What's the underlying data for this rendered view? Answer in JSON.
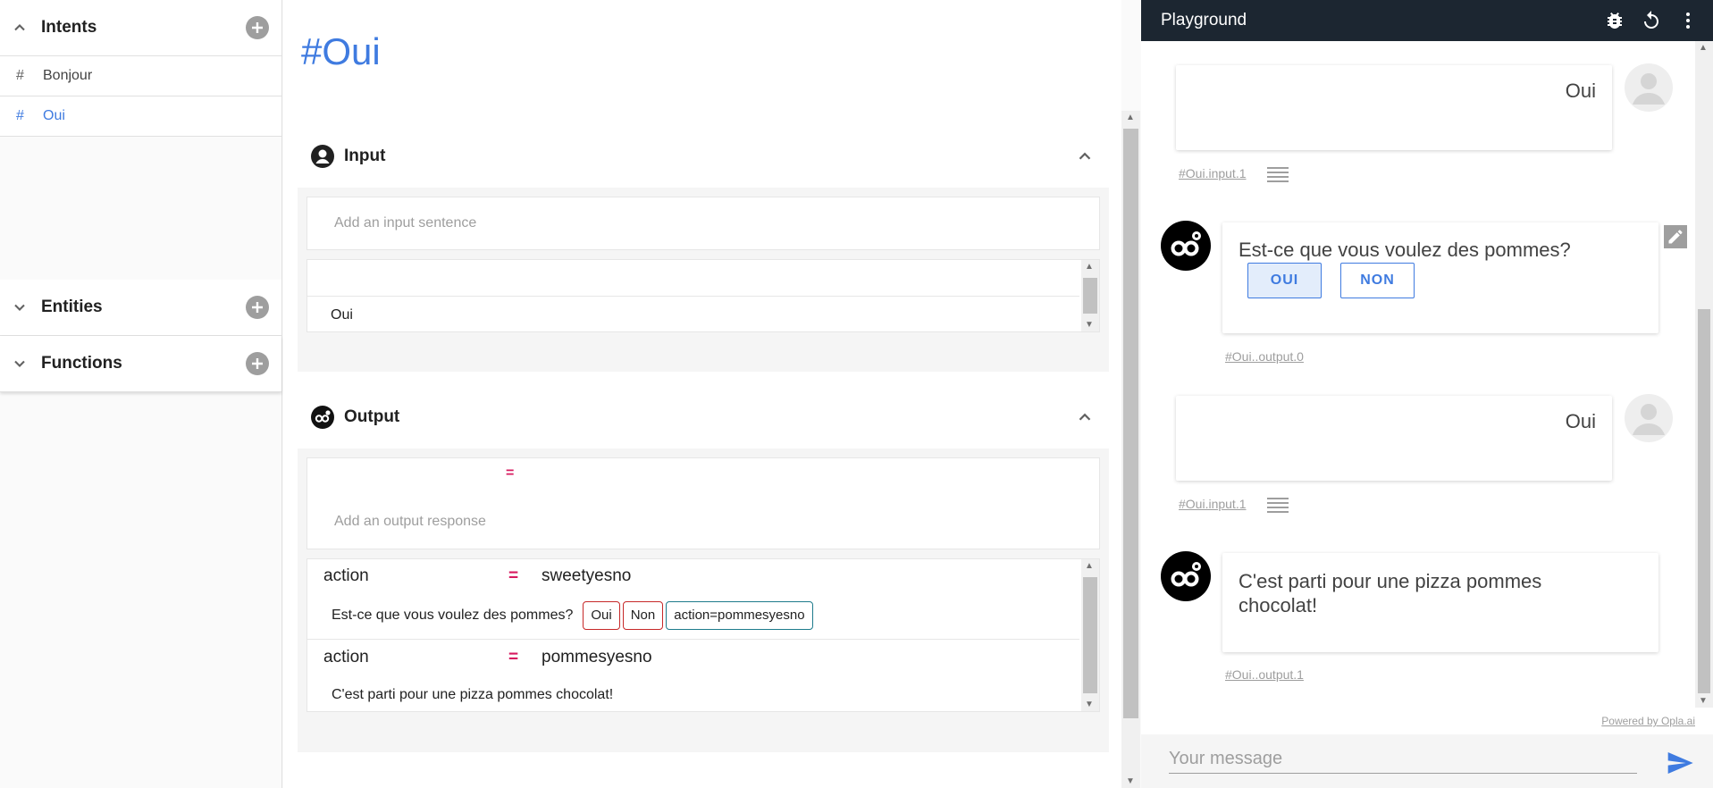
{
  "sidebar": {
    "intents_title": "Intents",
    "intents": [
      {
        "hash": "#",
        "label": "Bonjour"
      },
      {
        "hash": "#",
        "label": "Oui"
      }
    ],
    "entities_title": "Entities",
    "functions_title": "Functions"
  },
  "main": {
    "title": "#Oui",
    "input": {
      "title": "Input",
      "placeholder": "Add an input sentence",
      "sentences": [
        "Oui"
      ]
    },
    "output": {
      "title": "Output",
      "equals": "=",
      "placeholder": "Add an output response",
      "items": [
        {
          "key": "action",
          "value": "sweetyesno",
          "text": "Est-ce que vous voulez des pommes?",
          "chips": [
            "Oui",
            "Non",
            "action=pommesyesno"
          ]
        },
        {
          "key": "action",
          "value": "pommesyesno",
          "text": "C'est parti pour une pizza pommes chocolat!"
        }
      ]
    }
  },
  "playground": {
    "title": "Playground",
    "messages": [
      {
        "from": "user",
        "text": "Oui",
        "meta": "#Oui.input.1"
      },
      {
        "from": "bot",
        "text": "Est-ce que vous voulez des pommes?",
        "buttons": [
          "OUI",
          "NON"
        ],
        "meta": "#Oui..output.0"
      },
      {
        "from": "user",
        "text": "Oui",
        "meta": "#Oui.input.1"
      },
      {
        "from": "bot",
        "text": "C'est parti pour une pizza pommes chocolat!",
        "meta": "#Oui..output.1"
      }
    ],
    "powered_by": "Powered by Opla.ai",
    "composer_placeholder": "Your message"
  },
  "colors": {
    "accent": "#3f7be0",
    "topbar": "#1c2631",
    "equals": "#d81b60",
    "chip_red": "#c62828",
    "chip_teal": "#1e7b8c"
  }
}
